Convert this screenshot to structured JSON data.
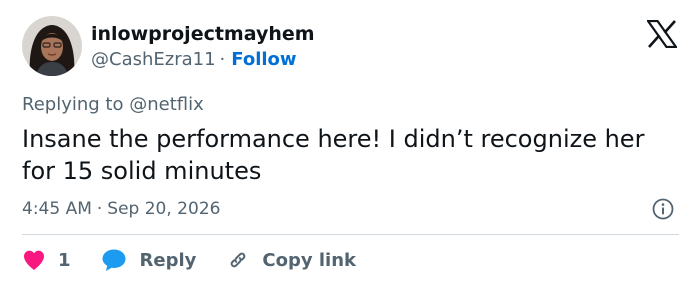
{
  "author": {
    "display_name": "inlowprojectmayhem",
    "handle": "@CashEzra11",
    "separator": "·",
    "follow_label": "Follow"
  },
  "reply_context": {
    "prefix": "Replying to",
    "mention": "@netflix"
  },
  "tweet": {
    "text": "Insane the performance here! I didn’t recognize her for 15 solid minutes",
    "time": "4:45 AM",
    "separator": "·",
    "date": "Sep 20, 2026"
  },
  "actions": {
    "like_count": "1",
    "reply_label": "Reply",
    "copy_link_label": "Copy link"
  },
  "icons": {
    "platform_logo": "x-logo-icon",
    "info": "info-icon",
    "like": "heart-icon",
    "reply": "speech-bubble-icon",
    "copy_link": "link-icon"
  },
  "colors": {
    "text_primary": "#0f1419",
    "text_secondary": "#536471",
    "follow_blue": "#006fd6",
    "like_pink": "#f91880",
    "reply_blue": "#1d9bf0",
    "divider": "#cfd9de"
  }
}
